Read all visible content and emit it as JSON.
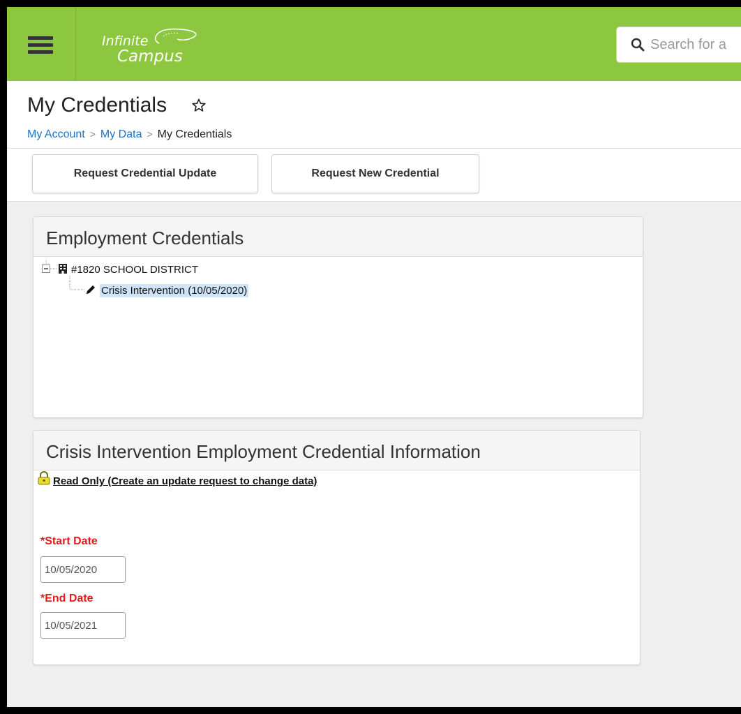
{
  "header": {
    "logo_line1": "Infinite",
    "logo_line2": "Campus",
    "search_placeholder": "Search for a",
    "brand_color": "#8dc63f"
  },
  "page": {
    "title": "My Credentials",
    "breadcrumb": [
      "My Account",
      "My Data",
      "My Credentials"
    ]
  },
  "actions": {
    "request_update": "Request Credential Update",
    "request_new": "Request New Credential"
  },
  "employment_panel": {
    "title": "Employment Credentials",
    "tree": {
      "district": "#1820 SCHOOL DISTRICT",
      "credential": "Crisis Intervention (10/05/2020)"
    }
  },
  "info_panel": {
    "title": "Crisis Intervention Employment Credential Information",
    "read_only_text": "Read Only (Create an update request to change data)",
    "start_label": "*Start Date",
    "start_value": "10/05/2020",
    "end_label": "*End Date",
    "end_value": "10/05/2021"
  },
  "icons": [
    "menu-icon",
    "search-icon",
    "star-icon",
    "tree-collapse-icon",
    "building-icon",
    "pencil-icon",
    "lock-icon"
  ]
}
